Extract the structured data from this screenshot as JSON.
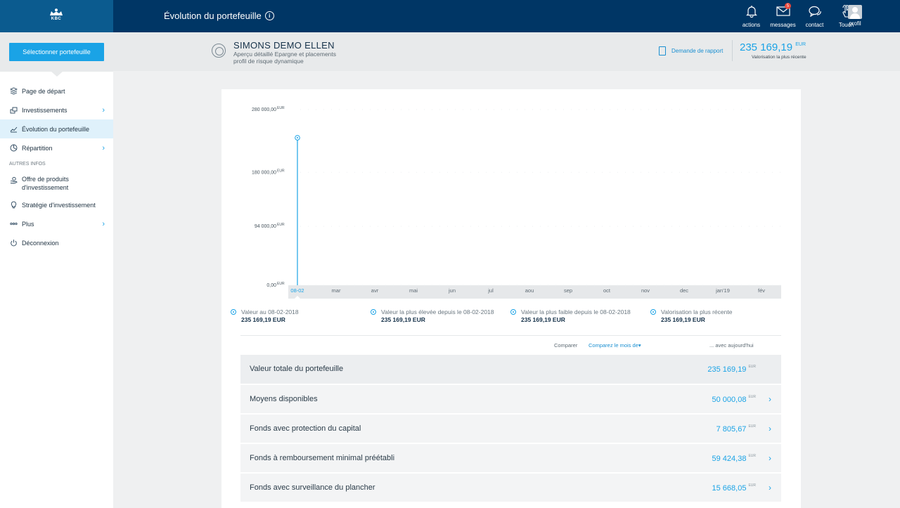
{
  "topbar": {
    "logo_text": "KBC",
    "title": "Évolution du portefeuille",
    "actions": [
      {
        "label": "actions",
        "icon": "bell-icon"
      },
      {
        "label": "messages",
        "icon": "envelope-icon",
        "badge": "5"
      },
      {
        "label": "contact",
        "icon": "chat-icon"
      },
      {
        "label": "Touch",
        "icon": "touch-hand-icon"
      }
    ],
    "profile_label": "profil"
  },
  "sidebar": {
    "select_button": "Sélectionner portefeuille",
    "items": [
      {
        "label": "Page de départ",
        "icon": "stack-icon"
      },
      {
        "label": "Investissements",
        "icon": "investments-icon",
        "chevron": true
      },
      {
        "label": "Évolution du portefeuille",
        "icon": "chart-line-icon",
        "active": true
      },
      {
        "label": "Répartition",
        "icon": "pie-icon",
        "chevron": true
      }
    ],
    "section_label": "AUTRES INFOS",
    "other_items": [
      {
        "label_line1": "Offre de produits",
        "label_line2": "d'investissement",
        "icon": "hand-coin-icon"
      },
      {
        "label": "Stratégie d'investissement",
        "icon": "lightbulb-icon"
      },
      {
        "label": "Plus",
        "icon": "dots-icon",
        "chevron": true
      },
      {
        "label": "Déconnexion",
        "icon": "power-icon"
      }
    ]
  },
  "header": {
    "client_name": "SIMONS DEMO ELLEN",
    "subtitle_line1": "Aperçu détaillé Epargne et placements",
    "subtitle_line2": "profil de risque dynamique",
    "report_link": "Demande de rapport",
    "total_value": "235 169,19",
    "total_currency": "EUR",
    "total_label": "Valorisation la plus récente"
  },
  "chart_data": {
    "type": "bar",
    "categories": [
      "08-02",
      "mar",
      "avr",
      "mai",
      "jun",
      "jul",
      "aou",
      "sep",
      "oct",
      "nov",
      "dec",
      "jan'19",
      "fév"
    ],
    "values": [
      235169.19,
      null,
      null,
      null,
      null,
      null,
      null,
      null,
      null,
      null,
      null,
      null,
      null
    ],
    "selected_category": "08-02",
    "y_ticks": [
      {
        "label": "280 000,00",
        "value": 280000
      },
      {
        "label": "180 000,00",
        "value": 180000
      },
      {
        "label": "94 000,00",
        "value": 94000
      },
      {
        "label": "0,00",
        "value": 0
      }
    ],
    "y_unit": "EUR",
    "ylim": [
      0,
      280000
    ],
    "color": "#1aa3e6"
  },
  "legend": [
    {
      "label": "Valeur au 08-02-2018",
      "value": "235 169,19 EUR"
    },
    {
      "label": "Valeur la plus élevée depuis le 08-02-2018",
      "value": "235 169,19 EUR"
    },
    {
      "label": "Valeur la plus faible depuis le 08-02-2018",
      "value": "235 169,19 EUR"
    },
    {
      "label": "Valorisation la plus récente",
      "value": "235 169,19 EUR"
    }
  ],
  "compare": {
    "label": "Comparer",
    "link": "Comparez le mois de",
    "today": "... avec aujourd'hui"
  },
  "rows": [
    {
      "label": "Valeur totale du portefeuille",
      "value": "235 169,19",
      "currency": "EUR",
      "chevron": false
    },
    {
      "label": "Moyens disponibles",
      "value": "50 000,08",
      "currency": "EUR",
      "chevron": true
    },
    {
      "label": "Fonds avec protection du capital",
      "value": "7 805,67",
      "currency": "EUR",
      "chevron": true
    },
    {
      "label": "Fonds à remboursement minimal préétabli",
      "value": "59 424,38",
      "currency": "EUR",
      "chevron": true
    },
    {
      "label": "Fonds avec surveillance du plancher",
      "value": "15 668,05",
      "currency": "EUR",
      "chevron": true
    }
  ]
}
